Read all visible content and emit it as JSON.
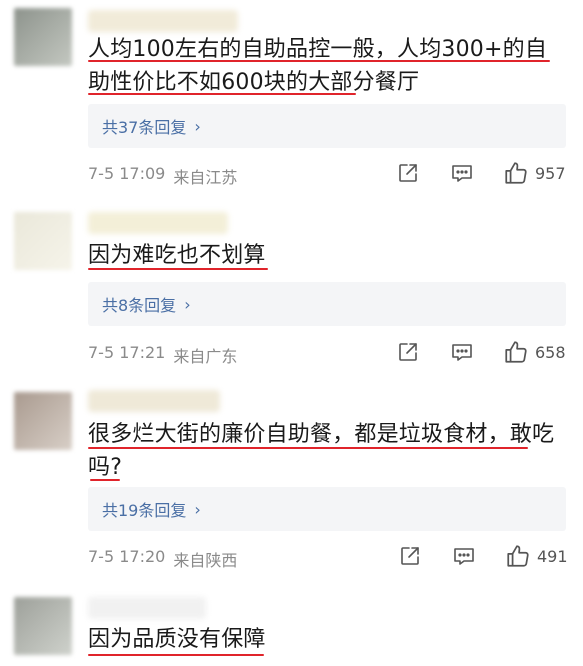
{
  "comments": [
    {
      "text": "人均100左右的自助品控一般，人均300+的自助性价比不如600块的大部分餐厅",
      "replies_label": "共37条回复",
      "time": "7-5 17:09",
      "location": "来自江苏",
      "likes": "957"
    },
    {
      "text": "因为难吃也不划算",
      "replies_label": "共8条回复",
      "time": "7-5 17:21",
      "location": "来自广东",
      "likes": "658"
    },
    {
      "text": "很多烂大街的廉价自助餐，都是垃圾食材，敢吃吗?",
      "replies_label": "共19条回复",
      "time": "7-5 17:20",
      "location": "来自陕西",
      "likes": "491"
    },
    {
      "text": "因为品质没有保障"
    }
  ],
  "icons": {
    "share": "share-icon",
    "comment": "comment-icon",
    "like": "thumbs-up-icon",
    "reply_arrow": "chevron-right-icon"
  },
  "colors": {
    "underline": "#e0242b",
    "reply_link": "#4a6fa5",
    "meta_text": "#8a8a8a",
    "reply_bg": "#f4f5f7"
  }
}
